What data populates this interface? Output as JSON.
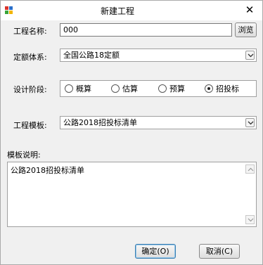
{
  "window": {
    "title": "新建工程"
  },
  "form": {
    "project_name": {
      "label": "工程名称:",
      "value": "000",
      "browse_label": "浏览"
    },
    "quota_system": {
      "label": "定额体系:",
      "value": "全国公路18定额"
    },
    "design_stage": {
      "label": "设计阶段:",
      "options": [
        "概算",
        "估算",
        "预算",
        "招投标"
      ],
      "selected": "招投标"
    },
    "template": {
      "label": "工程模板:",
      "value": "公路2018招投标清单"
    },
    "template_desc": {
      "label": "模板说明:",
      "value": "公路2018招投标清单"
    }
  },
  "buttons": {
    "ok": "确定(O)",
    "cancel": "取消(C)"
  },
  "colors": {
    "title_bg": "#ffffff",
    "window_bg": "#f0f0f0",
    "primary_border": "#3c7fb1"
  },
  "icons": [
    "app-icon",
    "close-icon",
    "chevron-down-icon",
    "scroll-up-icon",
    "scroll-down-icon"
  ]
}
